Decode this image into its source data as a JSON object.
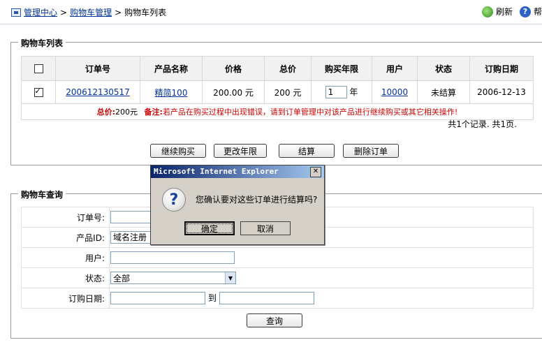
{
  "breadcrumb": {
    "item1": "管理中心",
    "sep": ">",
    "item2": "购物车管理",
    "item3": "购物车列表"
  },
  "top_actions": {
    "refresh": "刷新",
    "help": "帮助"
  },
  "cart": {
    "legend": "购物车列表",
    "headers": [
      "订单号",
      "产品名称",
      "价格",
      "总价",
      "购买年限",
      "用户",
      "状态",
      "订购日期"
    ],
    "row": {
      "order_no": "200612130517",
      "product": "精简100",
      "price": "200.00 元",
      "total": "200 元",
      "years": "1",
      "year_unit": "年",
      "user": "10000",
      "status": "未结算",
      "date": "2006-12-13"
    },
    "note_total_label": "总价:",
    "note_total_value": "200元",
    "note_label": "备注:",
    "note_text": "若产品在购买过程中出现错误，请到订单管理中对该产品进行继续购买或其它相关操作!",
    "summary": "共1个记录. 共1页.",
    "buttons": {
      "continue": "继续购买",
      "change_year": "更改年限",
      "checkout": "结算",
      "delete": "删除订单"
    }
  },
  "query": {
    "legend": "购物车查询",
    "labels": {
      "order_no": "订单号:",
      "product_id": "产品ID:",
      "user": "用户:",
      "status": "状态:",
      "date": "订购日期:"
    },
    "product_id_value": "域名注册",
    "status_value": "全部",
    "to": "到",
    "submit": "查询"
  },
  "dialog": {
    "title": "Microsoft Internet Explorer",
    "message": "您确认要对这些订单进行结算吗?",
    "ok": "确定",
    "cancel": "取消"
  }
}
